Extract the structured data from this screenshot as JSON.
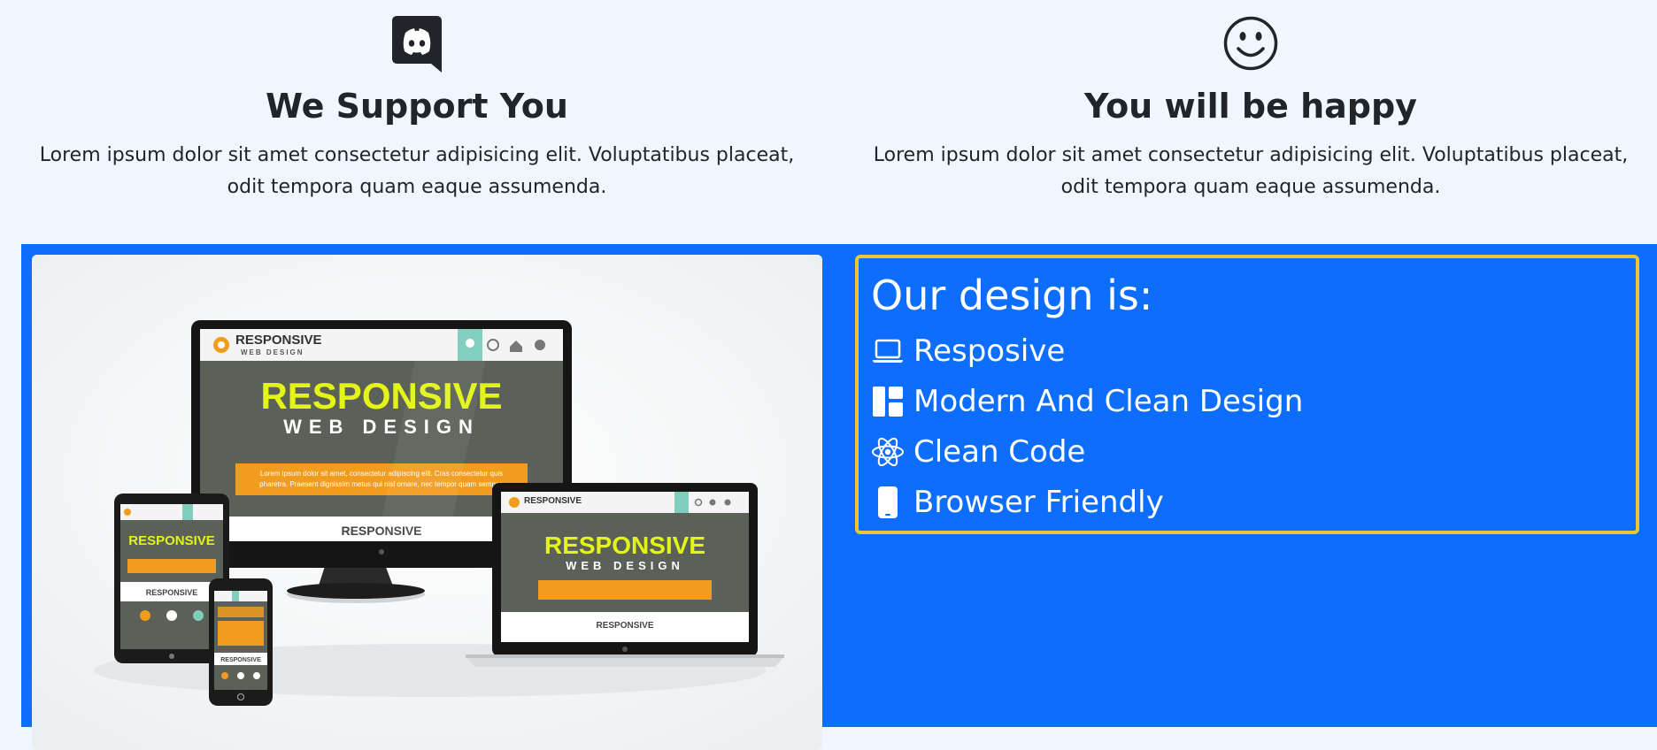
{
  "features": [
    {
      "icon": "discord-icon",
      "title": "We Support You",
      "text": "Lorem ipsum dolor sit amet consectetur adipisicing elit. Voluptatibus placeat, odit tempora quam eaque assumenda."
    },
    {
      "icon": "smiley-icon",
      "title": "You will be happy",
      "text": "Lorem ipsum dolor sit amet consectetur adipisicing elit. Voluptatibus placeat, odit tempora quam eaque assumenda."
    }
  ],
  "showcase": {
    "image_text": {
      "brand": "RESPONSIVE",
      "brand_sub": "WEB DESIGN",
      "headline": "RESPONSIVE",
      "subheadline": "WEB DESIGN",
      "section": "RESPONSIVE",
      "banner_line1": "Lorem ipsum dolor sit amet, consectetur adipiscing elit. Cras consectetur quis",
      "banner_line2": "pharetra. Praesent dignissim metus qui nisl ornare, nec tempor quam semper."
    },
    "design_heading": "Our design is:",
    "design_items": [
      {
        "icon": "laptop-icon",
        "label": "Resposive"
      },
      {
        "icon": "layout-icon",
        "label": "Modern And Clean Design"
      },
      {
        "icon": "react-atom-icon",
        "label": "Clean Code"
      },
      {
        "icon": "phone-icon",
        "label": "Browser Friendly"
      }
    ]
  },
  "colors": {
    "page_bg": "#f0f6fd",
    "band_blue": "#0d6efd",
    "box_border_yellow": "#f0c436",
    "image_lime": "#e2f516",
    "image_orange": "#f29c1f",
    "image_screen": "#5b6159",
    "image_teal": "#7ecdbd"
  }
}
